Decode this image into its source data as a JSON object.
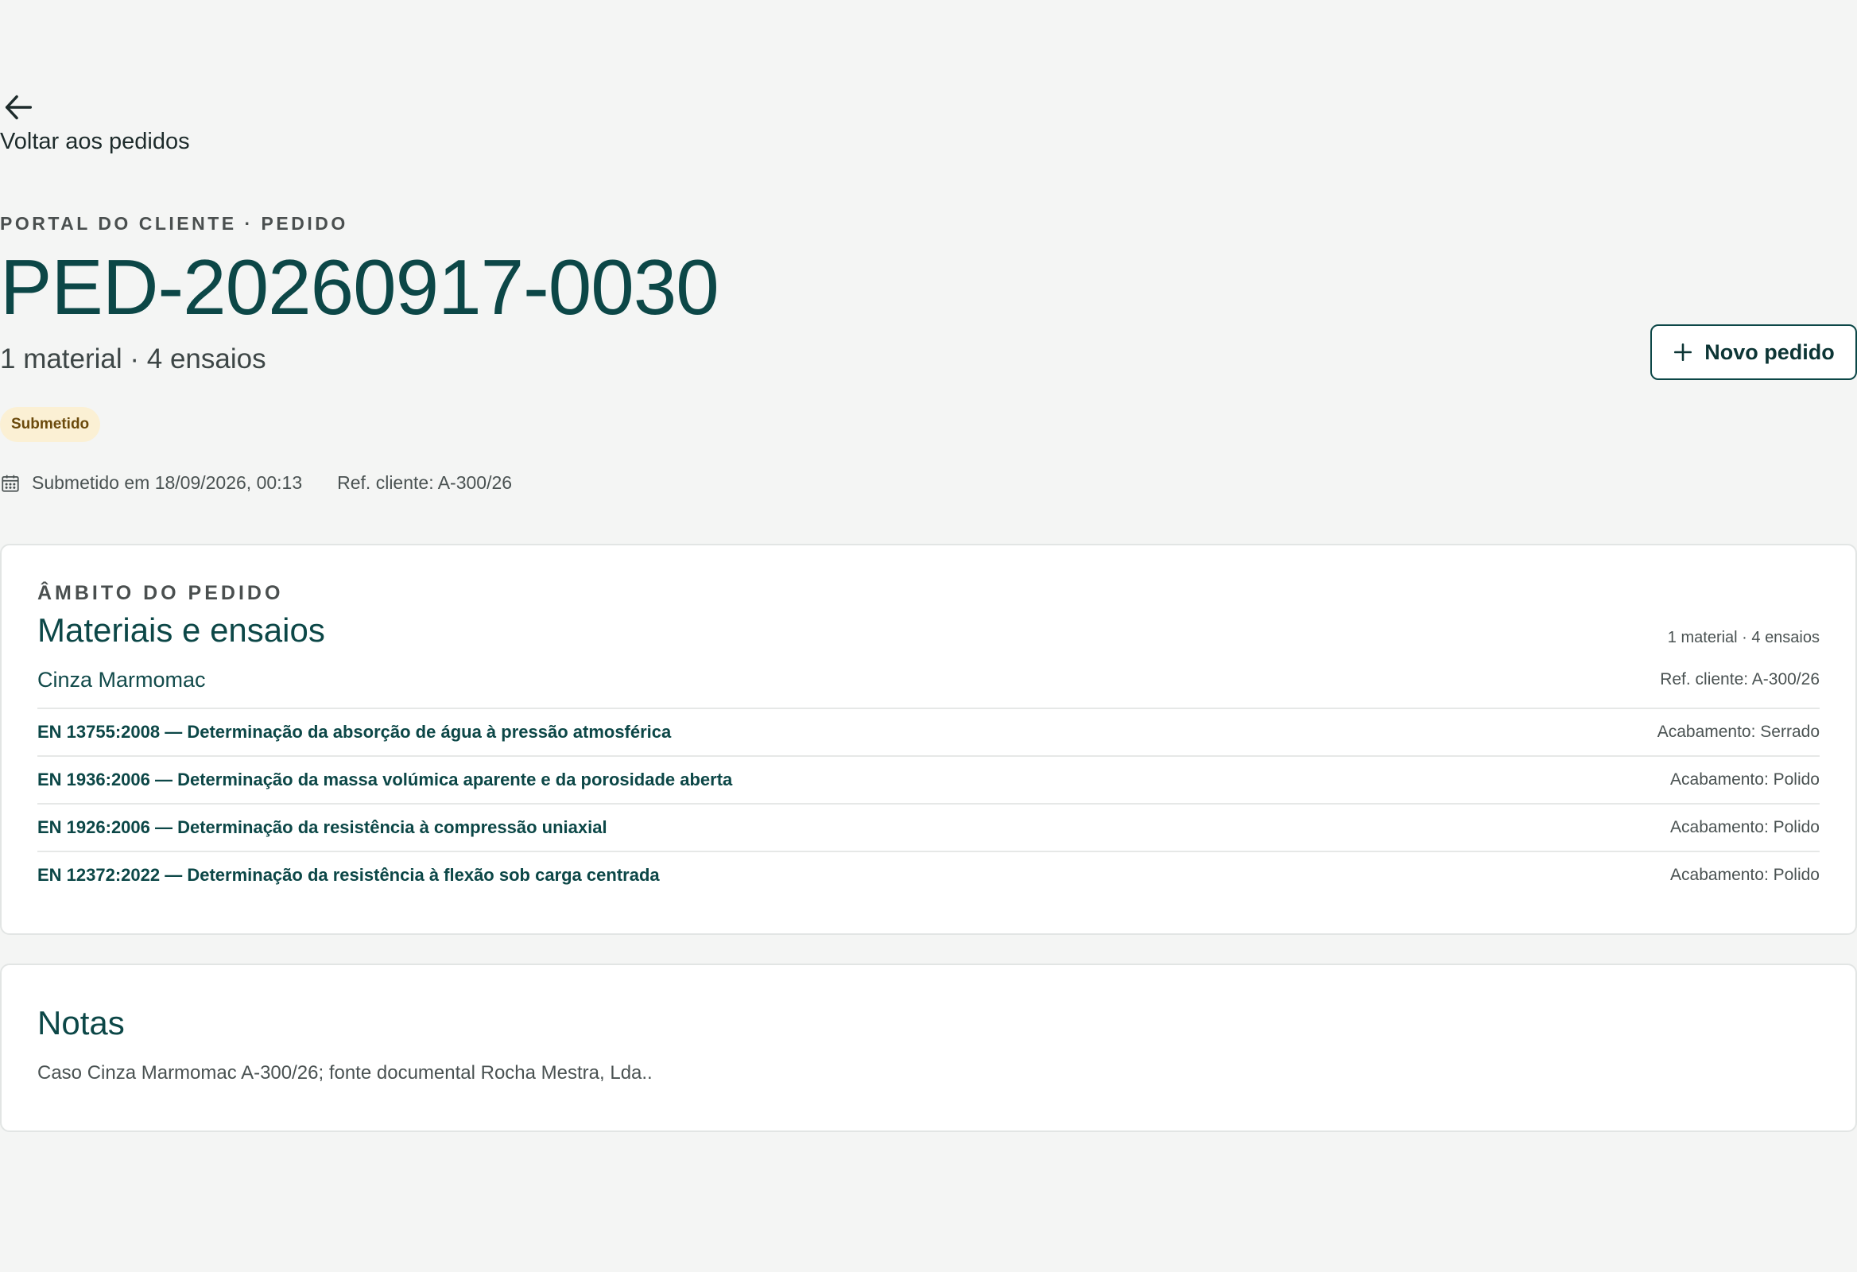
{
  "back": {
    "label": "Voltar aos pedidos",
    "icon": "arrow-left-icon"
  },
  "header": {
    "eyebrow": "PORTAL DO CLIENTE · PEDIDO",
    "order_id": "PED-20260917-0030",
    "summary": "1 material · 4 ensaios",
    "new_order_label": "Novo pedido",
    "status": "Submetido",
    "submitted": "Submetido em 18/09/2026, 00:13",
    "client_ref": "Ref. cliente: A-300/26"
  },
  "scope": {
    "eyebrow": "ÂMBITO DO PEDIDO",
    "title": "Materiais e ensaios",
    "count": "1 material · 4 ensaios",
    "material": {
      "name": "Cinza Marmomac",
      "ref": "Ref. cliente: A-300/26"
    },
    "tests": [
      {
        "name": "EN 13755:2008 — Determinação da absorção de água à pressão atmosférica",
        "finish": "Acabamento: Serrado"
      },
      {
        "name": "EN 1936:2006 — Determinação da massa volúmica aparente e da porosidade aberta",
        "finish": "Acabamento: Polido"
      },
      {
        "name": "EN 1926:2006 — Determinação da resistência à compressão uniaxial",
        "finish": "Acabamento: Polido"
      },
      {
        "name": "EN 12372:2022 — Determinação da resistência à flexão sob carga centrada",
        "finish": "Acabamento: Polido"
      }
    ]
  },
  "notes": {
    "title": "Notas",
    "text": "Caso Cinza Marmomac A-300/26; fonte documental Rocha Mestra, Lda.."
  },
  "colors": {
    "accent": "#0c4747",
    "background": "#f4f5f4",
    "status_bg": "#fbf0d4",
    "status_text": "#6b4a0c"
  }
}
